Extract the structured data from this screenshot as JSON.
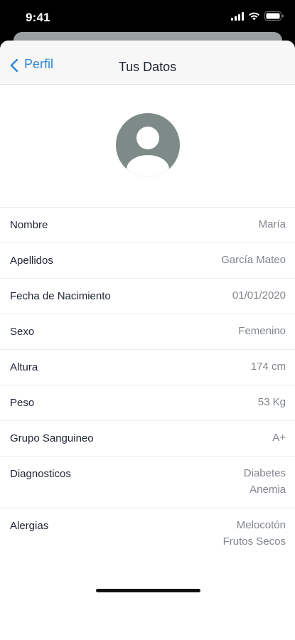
{
  "status_bar": {
    "time": "9:41",
    "icons": [
      "signal-icon",
      "wifi-icon",
      "battery-icon"
    ]
  },
  "nav": {
    "back_label": "Perfil",
    "title": "Tus Datos"
  },
  "colors": {
    "accent": "#2f86d6",
    "avatar": "#7d8a88",
    "label": "#1d2433",
    "value": "#80858c"
  },
  "fields": [
    {
      "label": "Nombre",
      "values": [
        "María"
      ]
    },
    {
      "label": "Apellidos",
      "values": [
        "García Mateo"
      ]
    },
    {
      "label": "Fecha de Nacimiento",
      "values": [
        "01/01/2020"
      ]
    },
    {
      "label": "Sexo",
      "values": [
        "Femenino"
      ]
    },
    {
      "label": "Altura",
      "values": [
        "174 cm"
      ]
    },
    {
      "label": "Peso",
      "values": [
        "53 Kg"
      ]
    },
    {
      "label": "Grupo Sanguineo",
      "values": [
        "A+"
      ]
    },
    {
      "label": "Diagnosticos",
      "values": [
        "Diabetes",
        "Anemia"
      ]
    },
    {
      "label": "Alergias",
      "values": [
        "Melocotón",
        "Frutos Secos"
      ]
    }
  ]
}
